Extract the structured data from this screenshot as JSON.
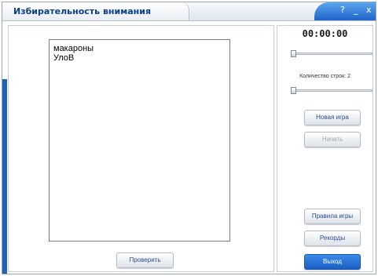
{
  "window": {
    "title": "Избирательность внимания",
    "controls": {
      "help": "?",
      "minimize": "_",
      "close": "x"
    }
  },
  "colors": {
    "title_text": "#0a3f8a",
    "control_bar": "#1e64c8",
    "accent": "#1e63b5",
    "exit_button": "#1a5fc4"
  },
  "game": {
    "lines": [
      "макароны",
      "УлоВ"
    ]
  },
  "sidebar": {
    "timer": "00:00:00",
    "rows_label": "Количество строк: 2",
    "speed_slider_level": 0,
    "rows_slider_level": 0,
    "new_game": "Новая игра",
    "start": "Начать",
    "rules": "Правила игры",
    "records": "Рекорды",
    "exit": "Выход"
  },
  "actions": {
    "check": "Проверить"
  }
}
